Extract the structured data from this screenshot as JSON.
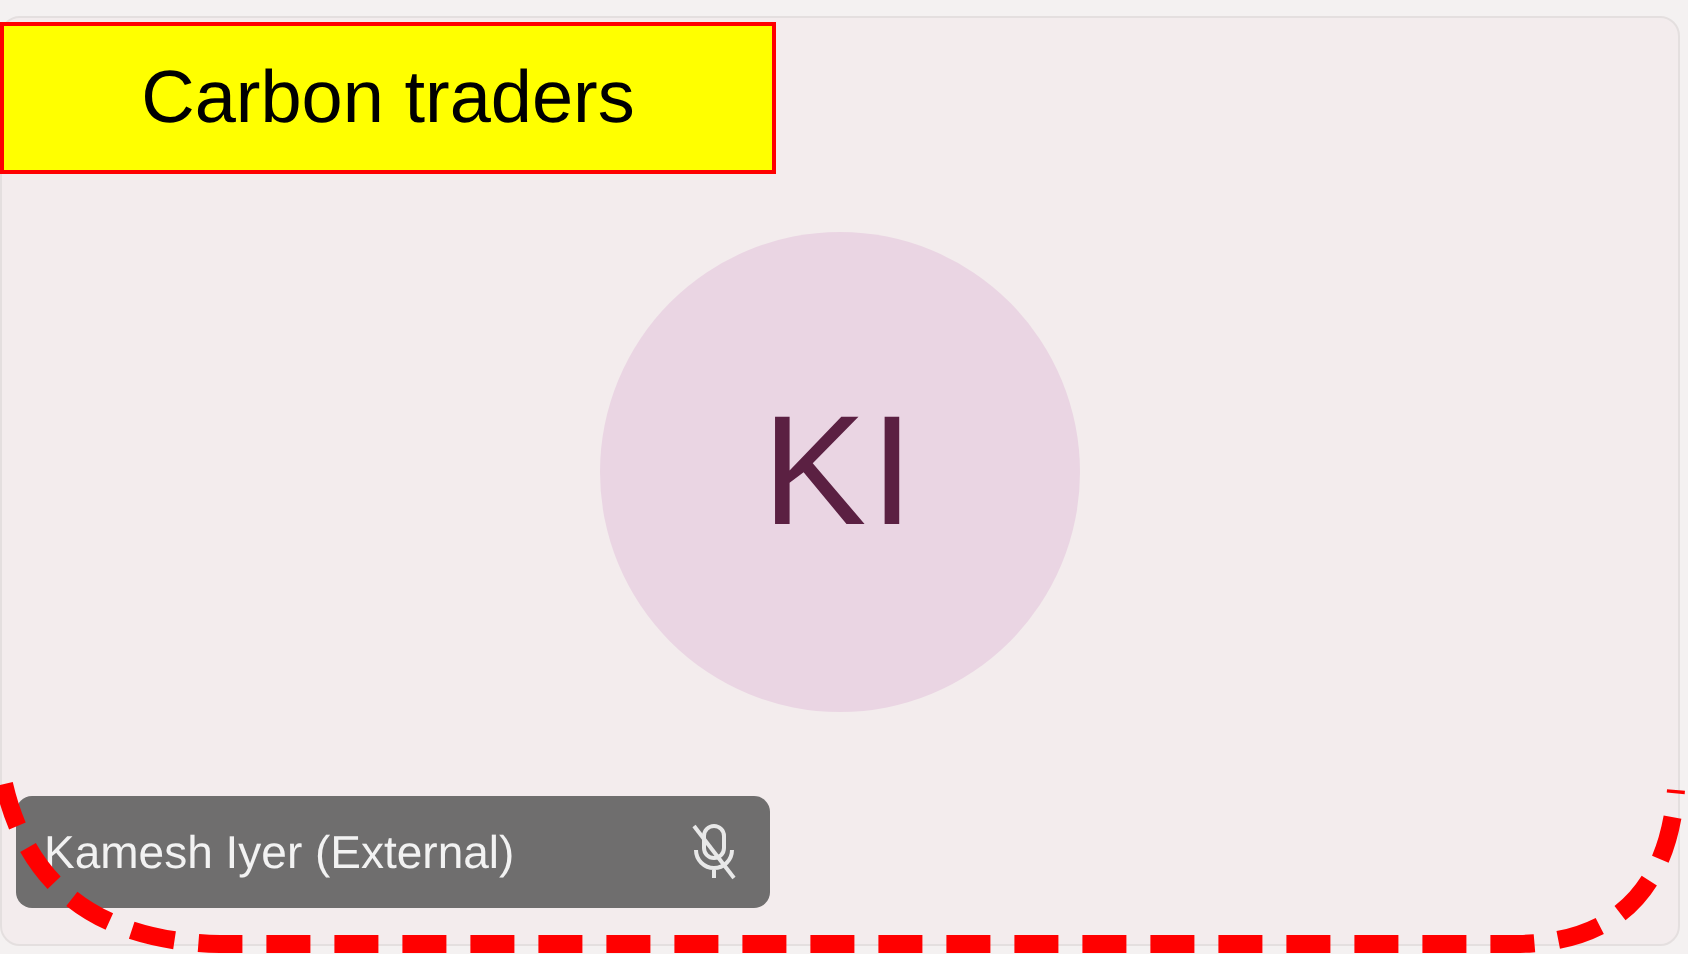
{
  "annotation": {
    "label": "Carbon traders",
    "outlined": true
  },
  "participant": {
    "initials": "KI",
    "name": "Kamesh Iyer (External)",
    "muted": true
  }
}
